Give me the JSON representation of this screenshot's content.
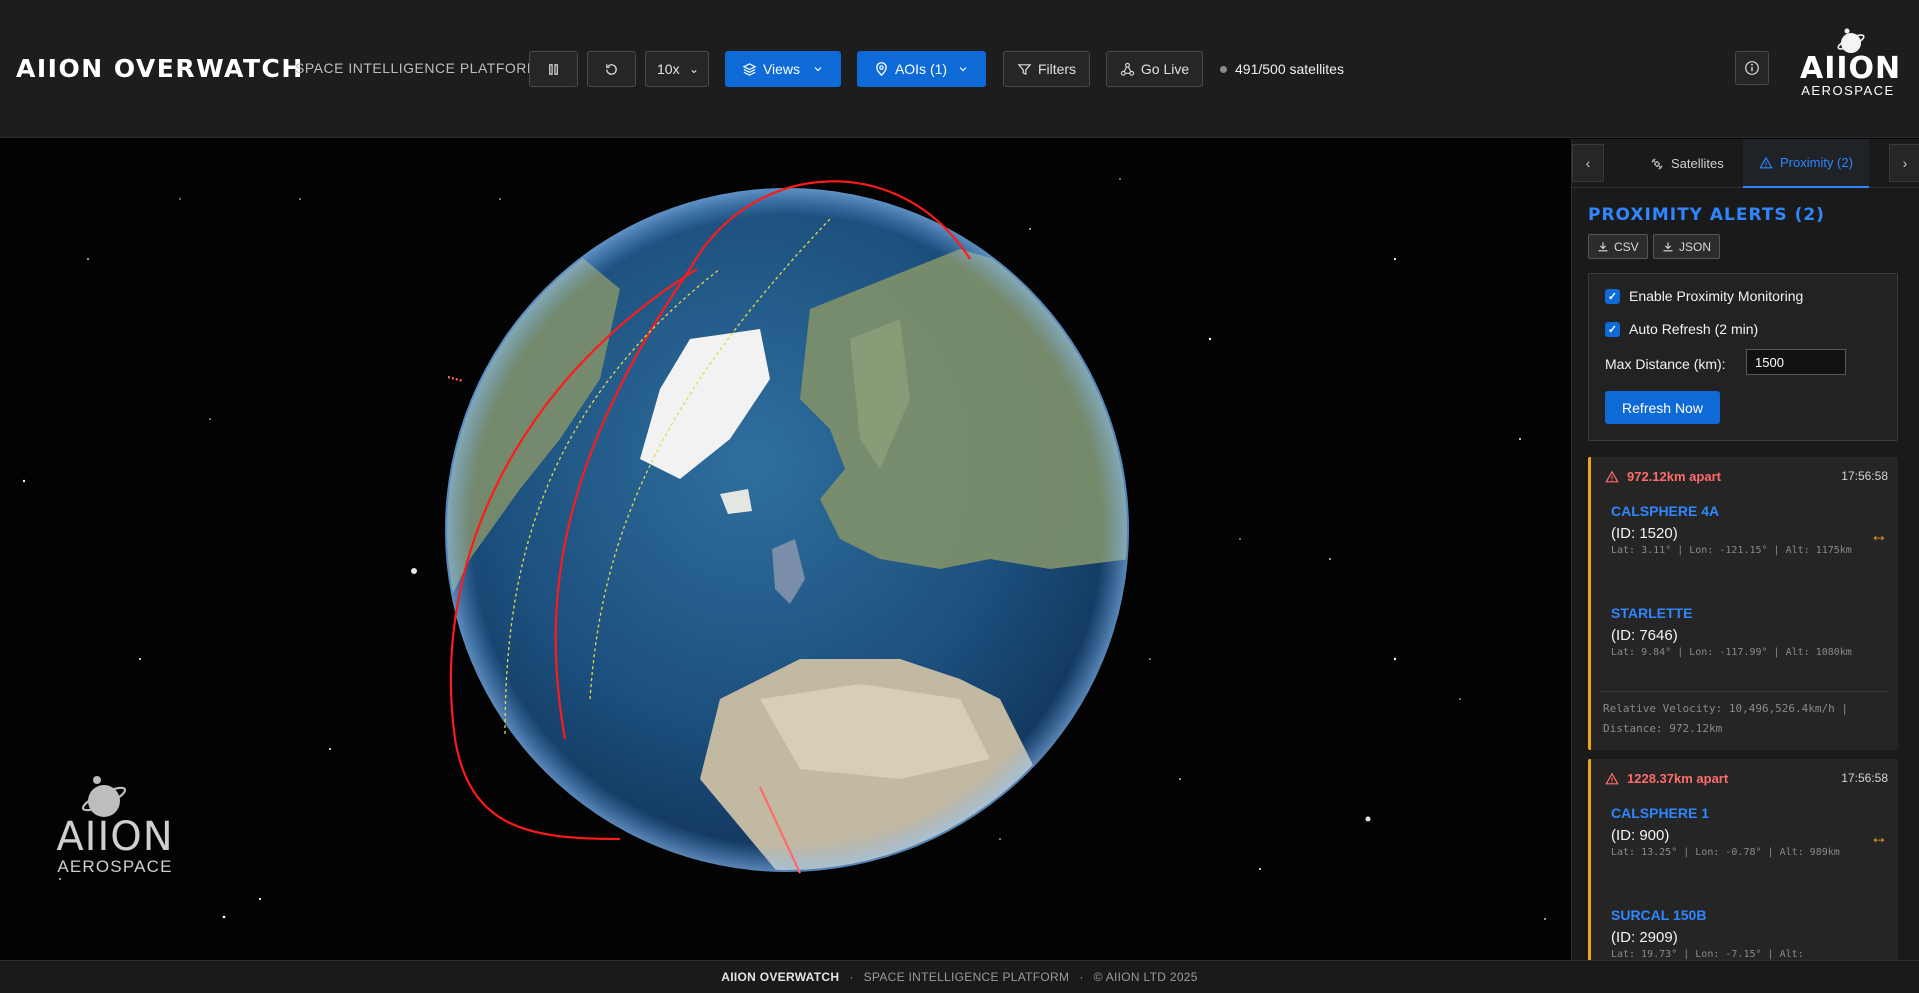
{
  "header": {
    "title": "AIION OVERWATCH",
    "subtitle": "SPACE INTELLIGENCE PLATFORM",
    "speed": "10x",
    "views_label": "Views",
    "aois_label": "AOIs (1)",
    "filters_label": "Filters",
    "golive_label": "Go Live",
    "sat_count": "491/500 satellites",
    "logo_line1": "AIION",
    "logo_line2": "AEROSPACE"
  },
  "viewer": {
    "logo_line1": "AIION",
    "logo_line2": "AEROSPACE"
  },
  "panel": {
    "tabs": [
      {
        "label": "Satellites"
      },
      {
        "label": "Proximity (2)"
      }
    ],
    "title": "PROXIMITY ALERTS (2)",
    "export_csv": "CSV",
    "export_json": "JSON",
    "settings": {
      "enable_label": "Enable Proximity Monitoring",
      "auto_label": "Auto Refresh (2 min)",
      "maxdist_label": "Max Distance (km):",
      "maxdist_value": "1500",
      "refresh_label": "Refresh Now"
    },
    "alerts": [
      {
        "distance": "972.12km apart",
        "time": "17:56:58",
        "sat1": {
          "name": "CALSPHERE 4A",
          "id": "(ID: 1520)",
          "pos": "Lat: 3.11° | Lon: -121.15° | Alt: 1175km"
        },
        "sat2": {
          "name": "STARLETTE",
          "id": "(ID: 7646)",
          "pos": "Lat: 9.84° | Lon: -117.99° | Alt: 1080km"
        },
        "footer": "Relative Velocity: 10,496,526.4km/h | Distance: 972.12km"
      },
      {
        "distance": "1228.37km apart",
        "time": "17:56:58",
        "sat1": {
          "name": "CALSPHERE 1",
          "id": "(ID: 900)",
          "pos": "Lat: 13.25° | Lon: -0.78° | Alt: 989km"
        },
        "sat2": {
          "name": "SURCAL 150B",
          "id": "(ID: 2909)",
          "pos": "Lat: 19.73° | Lon: -7.15° | Alt:"
        }
      }
    ]
  },
  "footer": {
    "brand": "AIION OVERWATCH",
    "sep1": "·",
    "platform": "SPACE INTELLIGENCE PLATFORM",
    "sep2": "·",
    "copyright": "© AIION LTD 2025"
  },
  "colors": {
    "accent": "#0d6ad6",
    "link": "#2f86ff",
    "alert": "#ff6b6b",
    "warning": "#f0a31c",
    "orbit": "#ff1a1a"
  }
}
